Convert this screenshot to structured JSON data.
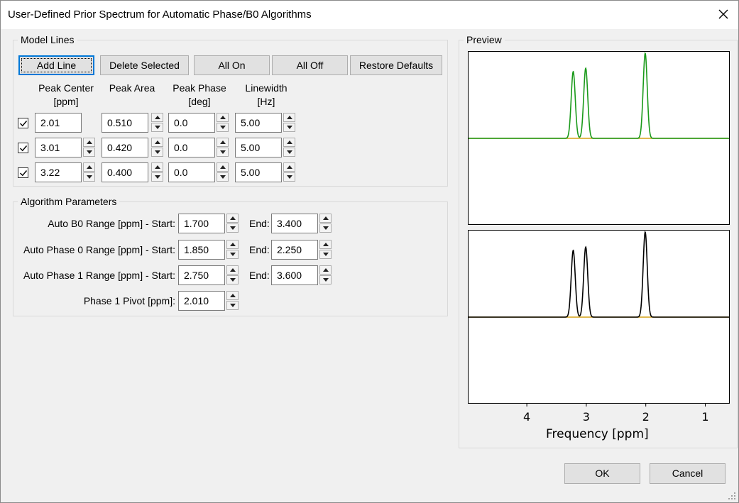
{
  "window": {
    "title": "User-Defined Prior Spectrum for Automatic Phase/B0 Algorithms"
  },
  "model_lines": {
    "group_title": "Model Lines",
    "buttons": {
      "add": "Add Line",
      "delete": "Delete Selected",
      "all_on": "All On",
      "all_off": "All Off",
      "restore": "Restore Defaults"
    },
    "headers": {
      "center": [
        "Peak Center",
        "[ppm]"
      ],
      "area": [
        "Peak Area"
      ],
      "phase": [
        "Peak Phase",
        "[deg]"
      ],
      "width": [
        "Linewidth",
        "[Hz]"
      ]
    },
    "rows": [
      {
        "checked": true,
        "center": "2.01",
        "area": "0.510",
        "phase": "0.0",
        "width": "5.00"
      },
      {
        "checked": true,
        "center": "3.01",
        "area": "0.420",
        "phase": "0.0",
        "width": "5.00"
      },
      {
        "checked": true,
        "center": "3.22",
        "area": "0.400",
        "phase": "0.0",
        "width": "5.00"
      }
    ]
  },
  "algorithm": {
    "group_title": "Algorithm Parameters",
    "end_label": "End:",
    "b0_label": "Auto B0 Range [ppm] - Start:",
    "b0_start": "1.700",
    "b0_end": "3.400",
    "phase0_label": "Auto Phase 0 Range [ppm] - Start:",
    "phase0_start": "1.850",
    "phase0_end": "2.250",
    "phase1_label": "Auto Phase 1 Range [ppm] - Start:",
    "phase1_start": "2.750",
    "phase1_end": "3.600",
    "pivot_label": "Phase 1 Pivot [ppm]:",
    "pivot": "2.010"
  },
  "preview": {
    "group_title": "Preview",
    "xlabel": "Frequency [ppm]",
    "ticks": [
      "4",
      "3",
      "2",
      "1"
    ]
  },
  "footer": {
    "ok": "OK",
    "cancel": "Cancel"
  },
  "chart_data": [
    {
      "type": "line",
      "x_axis": "ppm (reversed)",
      "xlim": [
        4.98,
        0.6
      ],
      "peaks": [
        {
          "center": 2.01,
          "area": 0.51
        },
        {
          "center": 3.01,
          "area": 0.42
        },
        {
          "center": 3.22,
          "area": 0.4
        }
      ],
      "colors": {
        "spectrum": "#1a9a1a",
        "baseline": "#d4a017"
      }
    },
    {
      "type": "line",
      "x_axis": "ppm (reversed)",
      "xlim": [
        4.98,
        0.6
      ],
      "xticks": [
        4,
        3,
        2,
        1
      ],
      "xlabel": "Frequency [ppm]",
      "peaks": [
        {
          "center": 2.01,
          "area": 0.51
        },
        {
          "center": 3.01,
          "area": 0.42
        },
        {
          "center": 3.22,
          "area": 0.4
        }
      ],
      "colors": {
        "spectrum": "#000000",
        "baseline": "#d4a017"
      }
    }
  ]
}
